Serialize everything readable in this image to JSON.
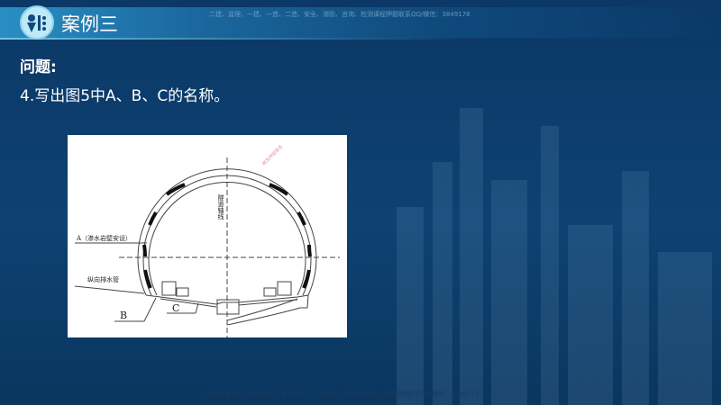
{
  "header": {
    "title": "案例三",
    "watermark": "二建、监理、一建、一造、二造、安全、消防、咨询、检测课程押题联系QQ/微信：3849178"
  },
  "question": {
    "label": "问题:",
    "text": "4.写出图5中A、B、C的名称。"
  },
  "diagram": {
    "label_a": "A（渗水岩壁安设）",
    "axis_label": "隧道轴线",
    "pipe_label": "纵向排水管",
    "label_b": "B",
    "label_c": "C",
    "stamp": "精准押题联系"
  },
  "footer": {
    "watermark": "名师直播精华、类会内容、考点串讲、习题精考、考前三页纸、押题押题联系QQ/微信：3849178"
  }
}
